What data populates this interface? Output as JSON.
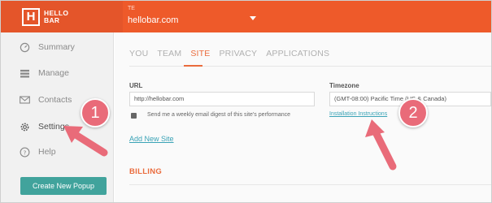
{
  "header": {
    "logo_text_line1": "HELLO",
    "logo_text_line2": "BAR",
    "site_small_label": "TE",
    "site_name": "hellobar.com"
  },
  "sidebar": {
    "items": [
      {
        "label": "Summary",
        "icon": "gauge-icon"
      },
      {
        "label": "Manage",
        "icon": "list-icon"
      },
      {
        "label": "Contacts",
        "icon": "envelope-icon"
      },
      {
        "label": "Settings",
        "icon": "gear-icon"
      },
      {
        "label": "Help",
        "icon": "question-icon"
      }
    ],
    "create_button": "Create New Popup"
  },
  "main": {
    "tabs": [
      "YOU",
      "TEAM",
      "SITE",
      "PRIVACY",
      "APPLICATIONS"
    ],
    "active_tab": "SITE",
    "url_label": "URL",
    "url_value": "http://hellobar.com",
    "digest_label": "Send me a weekly email digest of this site's performance",
    "digest_checked": true,
    "add_site_link": "Add New Site",
    "timezone_label": "Timezone",
    "timezone_value": "(GMT-08:00) Pacific Time (US & Canada)",
    "install_link": "Installation Instructions",
    "billing_heading": "BILLING"
  },
  "annotations": [
    {
      "number": "1"
    },
    {
      "number": "2"
    }
  ],
  "colors": {
    "brand_orange": "#ee5a2a",
    "accent_orange": "#ea6b3c",
    "teal_button": "#41a39c",
    "link_blue": "#3aa3b6",
    "annotation_pink": "#e96b79"
  }
}
